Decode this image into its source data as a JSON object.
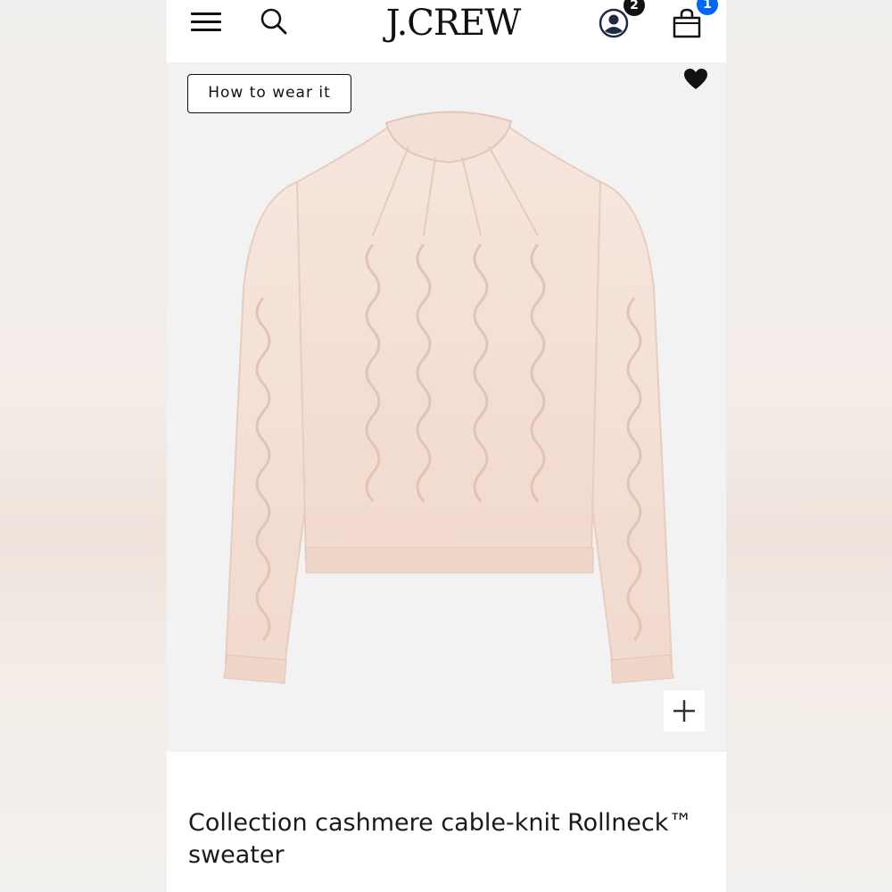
{
  "header": {
    "logo_text": "J.CREW",
    "account_badge_count": "2",
    "bag_badge_count": "1",
    "bag_badge_color": "#0066ff",
    "account_badge_color": "#111111",
    "icons": [
      "menu-icon",
      "search-icon",
      "account-icon",
      "bag-icon"
    ]
  },
  "product": {
    "how_to_wear_label": "How to wear it",
    "favorite_icon": "heart-icon",
    "zoom_icon": "plus-icon",
    "image_subject": "sweater",
    "image_color": "#f4dfd4",
    "title": "Collection cashmere cable-knit Rollneck™ sweater"
  }
}
